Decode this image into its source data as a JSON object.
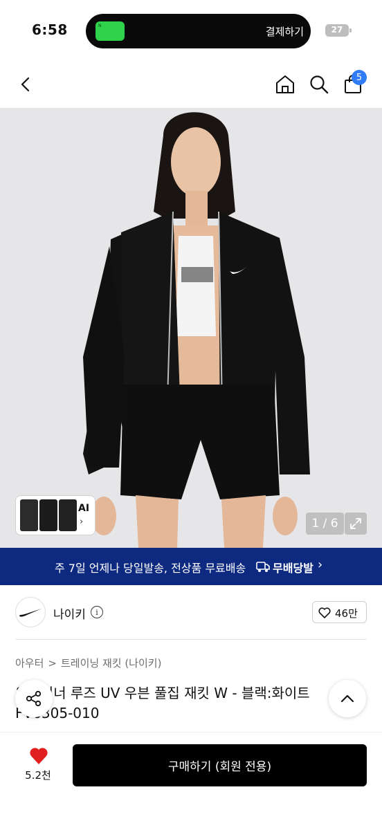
{
  "status_bar": {
    "time": "6:58",
    "island_label": "결제하기",
    "battery": "27"
  },
  "header": {
    "cart_count": "5"
  },
  "gallery": {
    "pager": "1 / 6",
    "ai_label": "AI",
    "ai_chevron": "›"
  },
  "banner": {
    "text": "주 7일 언제나 당일발송, 전상품 무료배송",
    "brand": "무배당발",
    "chevron": "›",
    "colors": {
      "background": "#0e2a80"
    }
  },
  "brand": {
    "name": "나이키",
    "like_count": "46만"
  },
  "breadcrumb": {
    "category": "아우터",
    "separator": ">",
    "subcategory": "트레이닝 재킷 (나이키)"
  },
  "product": {
    "title_line1_visible": "윈드러너 루즈 UV 우븐 풀집 재킷 W - 블랙:화이트",
    "title_line2_visible": "FV6305-010"
  },
  "bottom": {
    "wish_count": "5.2천",
    "buy_label": "구매하기 (회원 전용)",
    "colors": {
      "heart": "#e02020",
      "buy_button": "#000000"
    }
  },
  "icons": [
    "back-icon",
    "home-icon",
    "search-icon",
    "bag-icon",
    "expand-icon",
    "nike-swoosh-icon",
    "info-icon",
    "heart-outline-icon",
    "share-icon",
    "chevron-up-icon",
    "heart-filled-icon",
    "truck-icon"
  ]
}
